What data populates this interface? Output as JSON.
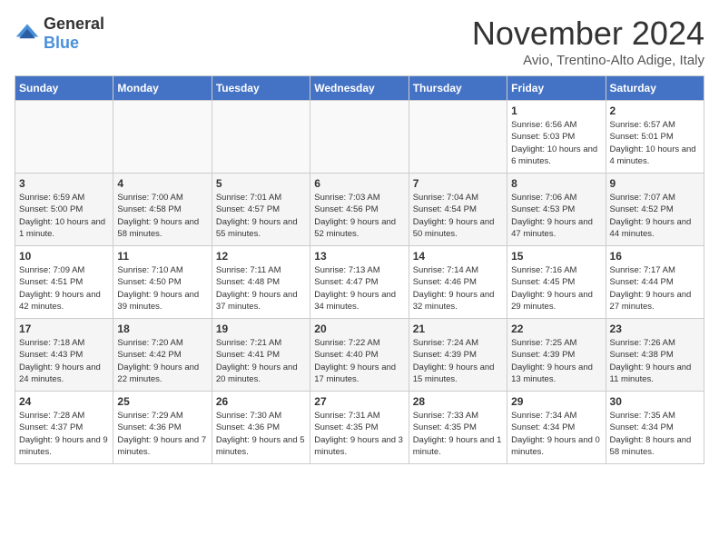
{
  "logo": {
    "general": "General",
    "blue": "Blue"
  },
  "title": "November 2024",
  "subtitle": "Avio, Trentino-Alto Adige, Italy",
  "days_of_week": [
    "Sunday",
    "Monday",
    "Tuesday",
    "Wednesday",
    "Thursday",
    "Friday",
    "Saturday"
  ],
  "weeks": [
    [
      {
        "day": "",
        "info": ""
      },
      {
        "day": "",
        "info": ""
      },
      {
        "day": "",
        "info": ""
      },
      {
        "day": "",
        "info": ""
      },
      {
        "day": "",
        "info": ""
      },
      {
        "day": "1",
        "info": "Sunrise: 6:56 AM\nSunset: 5:03 PM\nDaylight: 10 hours and 6 minutes."
      },
      {
        "day": "2",
        "info": "Sunrise: 6:57 AM\nSunset: 5:01 PM\nDaylight: 10 hours and 4 minutes."
      }
    ],
    [
      {
        "day": "3",
        "info": "Sunrise: 6:59 AM\nSunset: 5:00 PM\nDaylight: 10 hours and 1 minute."
      },
      {
        "day": "4",
        "info": "Sunrise: 7:00 AM\nSunset: 4:58 PM\nDaylight: 9 hours and 58 minutes."
      },
      {
        "day": "5",
        "info": "Sunrise: 7:01 AM\nSunset: 4:57 PM\nDaylight: 9 hours and 55 minutes."
      },
      {
        "day": "6",
        "info": "Sunrise: 7:03 AM\nSunset: 4:56 PM\nDaylight: 9 hours and 52 minutes."
      },
      {
        "day": "7",
        "info": "Sunrise: 7:04 AM\nSunset: 4:54 PM\nDaylight: 9 hours and 50 minutes."
      },
      {
        "day": "8",
        "info": "Sunrise: 7:06 AM\nSunset: 4:53 PM\nDaylight: 9 hours and 47 minutes."
      },
      {
        "day": "9",
        "info": "Sunrise: 7:07 AM\nSunset: 4:52 PM\nDaylight: 9 hours and 44 minutes."
      }
    ],
    [
      {
        "day": "10",
        "info": "Sunrise: 7:09 AM\nSunset: 4:51 PM\nDaylight: 9 hours and 42 minutes."
      },
      {
        "day": "11",
        "info": "Sunrise: 7:10 AM\nSunset: 4:50 PM\nDaylight: 9 hours and 39 minutes."
      },
      {
        "day": "12",
        "info": "Sunrise: 7:11 AM\nSunset: 4:48 PM\nDaylight: 9 hours and 37 minutes."
      },
      {
        "day": "13",
        "info": "Sunrise: 7:13 AM\nSunset: 4:47 PM\nDaylight: 9 hours and 34 minutes."
      },
      {
        "day": "14",
        "info": "Sunrise: 7:14 AM\nSunset: 4:46 PM\nDaylight: 9 hours and 32 minutes."
      },
      {
        "day": "15",
        "info": "Sunrise: 7:16 AM\nSunset: 4:45 PM\nDaylight: 9 hours and 29 minutes."
      },
      {
        "day": "16",
        "info": "Sunrise: 7:17 AM\nSunset: 4:44 PM\nDaylight: 9 hours and 27 minutes."
      }
    ],
    [
      {
        "day": "17",
        "info": "Sunrise: 7:18 AM\nSunset: 4:43 PM\nDaylight: 9 hours and 24 minutes."
      },
      {
        "day": "18",
        "info": "Sunrise: 7:20 AM\nSunset: 4:42 PM\nDaylight: 9 hours and 22 minutes."
      },
      {
        "day": "19",
        "info": "Sunrise: 7:21 AM\nSunset: 4:41 PM\nDaylight: 9 hours and 20 minutes."
      },
      {
        "day": "20",
        "info": "Sunrise: 7:22 AM\nSunset: 4:40 PM\nDaylight: 9 hours and 17 minutes."
      },
      {
        "day": "21",
        "info": "Sunrise: 7:24 AM\nSunset: 4:39 PM\nDaylight: 9 hours and 15 minutes."
      },
      {
        "day": "22",
        "info": "Sunrise: 7:25 AM\nSunset: 4:39 PM\nDaylight: 9 hours and 13 minutes."
      },
      {
        "day": "23",
        "info": "Sunrise: 7:26 AM\nSunset: 4:38 PM\nDaylight: 9 hours and 11 minutes."
      }
    ],
    [
      {
        "day": "24",
        "info": "Sunrise: 7:28 AM\nSunset: 4:37 PM\nDaylight: 9 hours and 9 minutes."
      },
      {
        "day": "25",
        "info": "Sunrise: 7:29 AM\nSunset: 4:36 PM\nDaylight: 9 hours and 7 minutes."
      },
      {
        "day": "26",
        "info": "Sunrise: 7:30 AM\nSunset: 4:36 PM\nDaylight: 9 hours and 5 minutes."
      },
      {
        "day": "27",
        "info": "Sunrise: 7:31 AM\nSunset: 4:35 PM\nDaylight: 9 hours and 3 minutes."
      },
      {
        "day": "28",
        "info": "Sunrise: 7:33 AM\nSunset: 4:35 PM\nDaylight: 9 hours and 1 minute."
      },
      {
        "day": "29",
        "info": "Sunrise: 7:34 AM\nSunset: 4:34 PM\nDaylight: 9 hours and 0 minutes."
      },
      {
        "day": "30",
        "info": "Sunrise: 7:35 AM\nSunset: 4:34 PM\nDaylight: 8 hours and 58 minutes."
      }
    ]
  ]
}
